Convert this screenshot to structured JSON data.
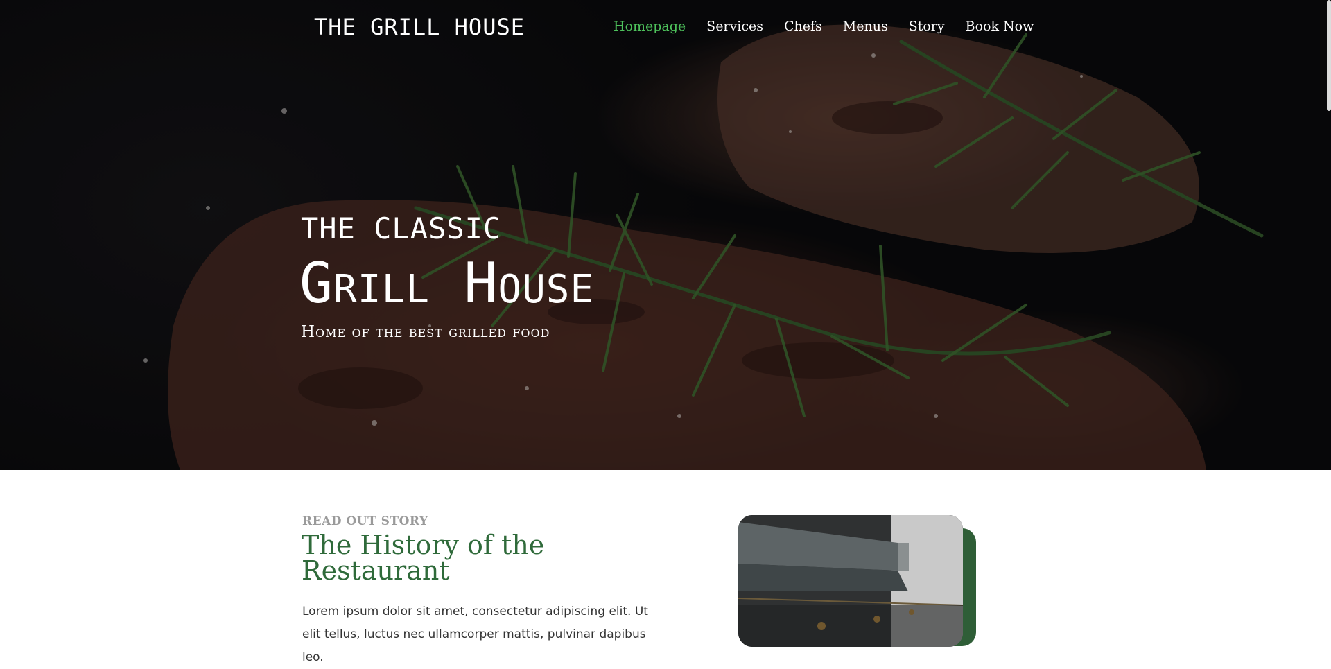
{
  "header": {
    "brand": "THE GRILL HOUSE",
    "nav": [
      {
        "label": "Homepage",
        "active": true
      },
      {
        "label": "Services",
        "active": false
      },
      {
        "label": "Chefs",
        "active": false
      },
      {
        "label": "Menus",
        "active": false
      },
      {
        "label": "Story",
        "active": false
      },
      {
        "label": "Book Now",
        "active": false
      }
    ]
  },
  "hero": {
    "eyebrow": "THE CLASSIC",
    "title": "Grill House",
    "subtitle": "Home of the best grilled food"
  },
  "story": {
    "eyebrow": "READ OUT STORY",
    "title": "The History of the Restaurant",
    "body": "Lorem ipsum dolor sit amet, consectetur adipiscing elit. Ut elit tellus, luctus nec ullamcorper mattis, pulvinar dapibus leo."
  },
  "colors": {
    "accent": "#4ec25c",
    "brand_green": "#2f6a3a",
    "card_accent": "#2f5e37"
  }
}
